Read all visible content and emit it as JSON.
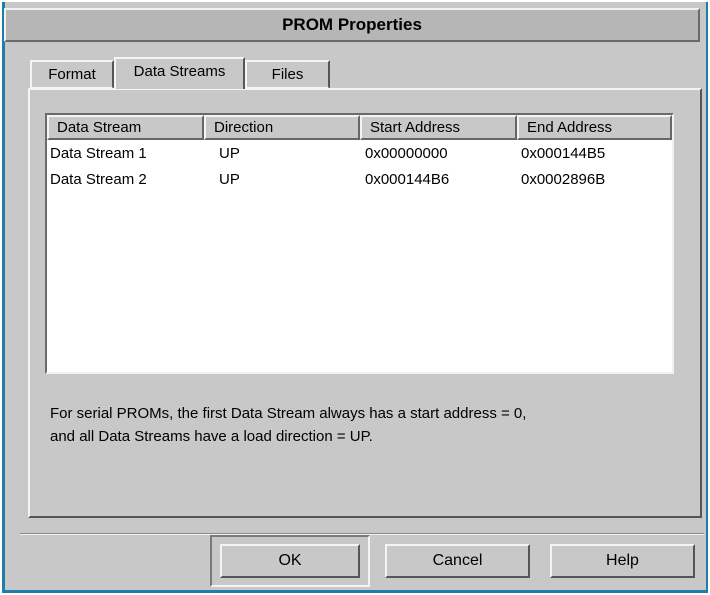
{
  "window": {
    "title": "PROM Properties"
  },
  "tabs": [
    {
      "label": "Format",
      "active": false
    },
    {
      "label": "Data Streams",
      "active": true
    },
    {
      "label": "Files",
      "active": false
    }
  ],
  "table": {
    "columns": [
      "Data Stream",
      "Direction",
      "Start Address",
      "End Address"
    ],
    "rows": [
      [
        "Data Stream 1",
        "UP",
        "0x00000000",
        "0x000144B5"
      ],
      [
        "Data Stream 2",
        "UP",
        "0x000144B6",
        "0x0002896B"
      ]
    ]
  },
  "note": {
    "line1": "For serial PROMs, the first Data Stream always has a start address = 0,",
    "line2": "and all Data Streams have a load direction = UP."
  },
  "buttons": {
    "ok": "OK",
    "cancel": "Cancel",
    "help": "Help"
  }
}
